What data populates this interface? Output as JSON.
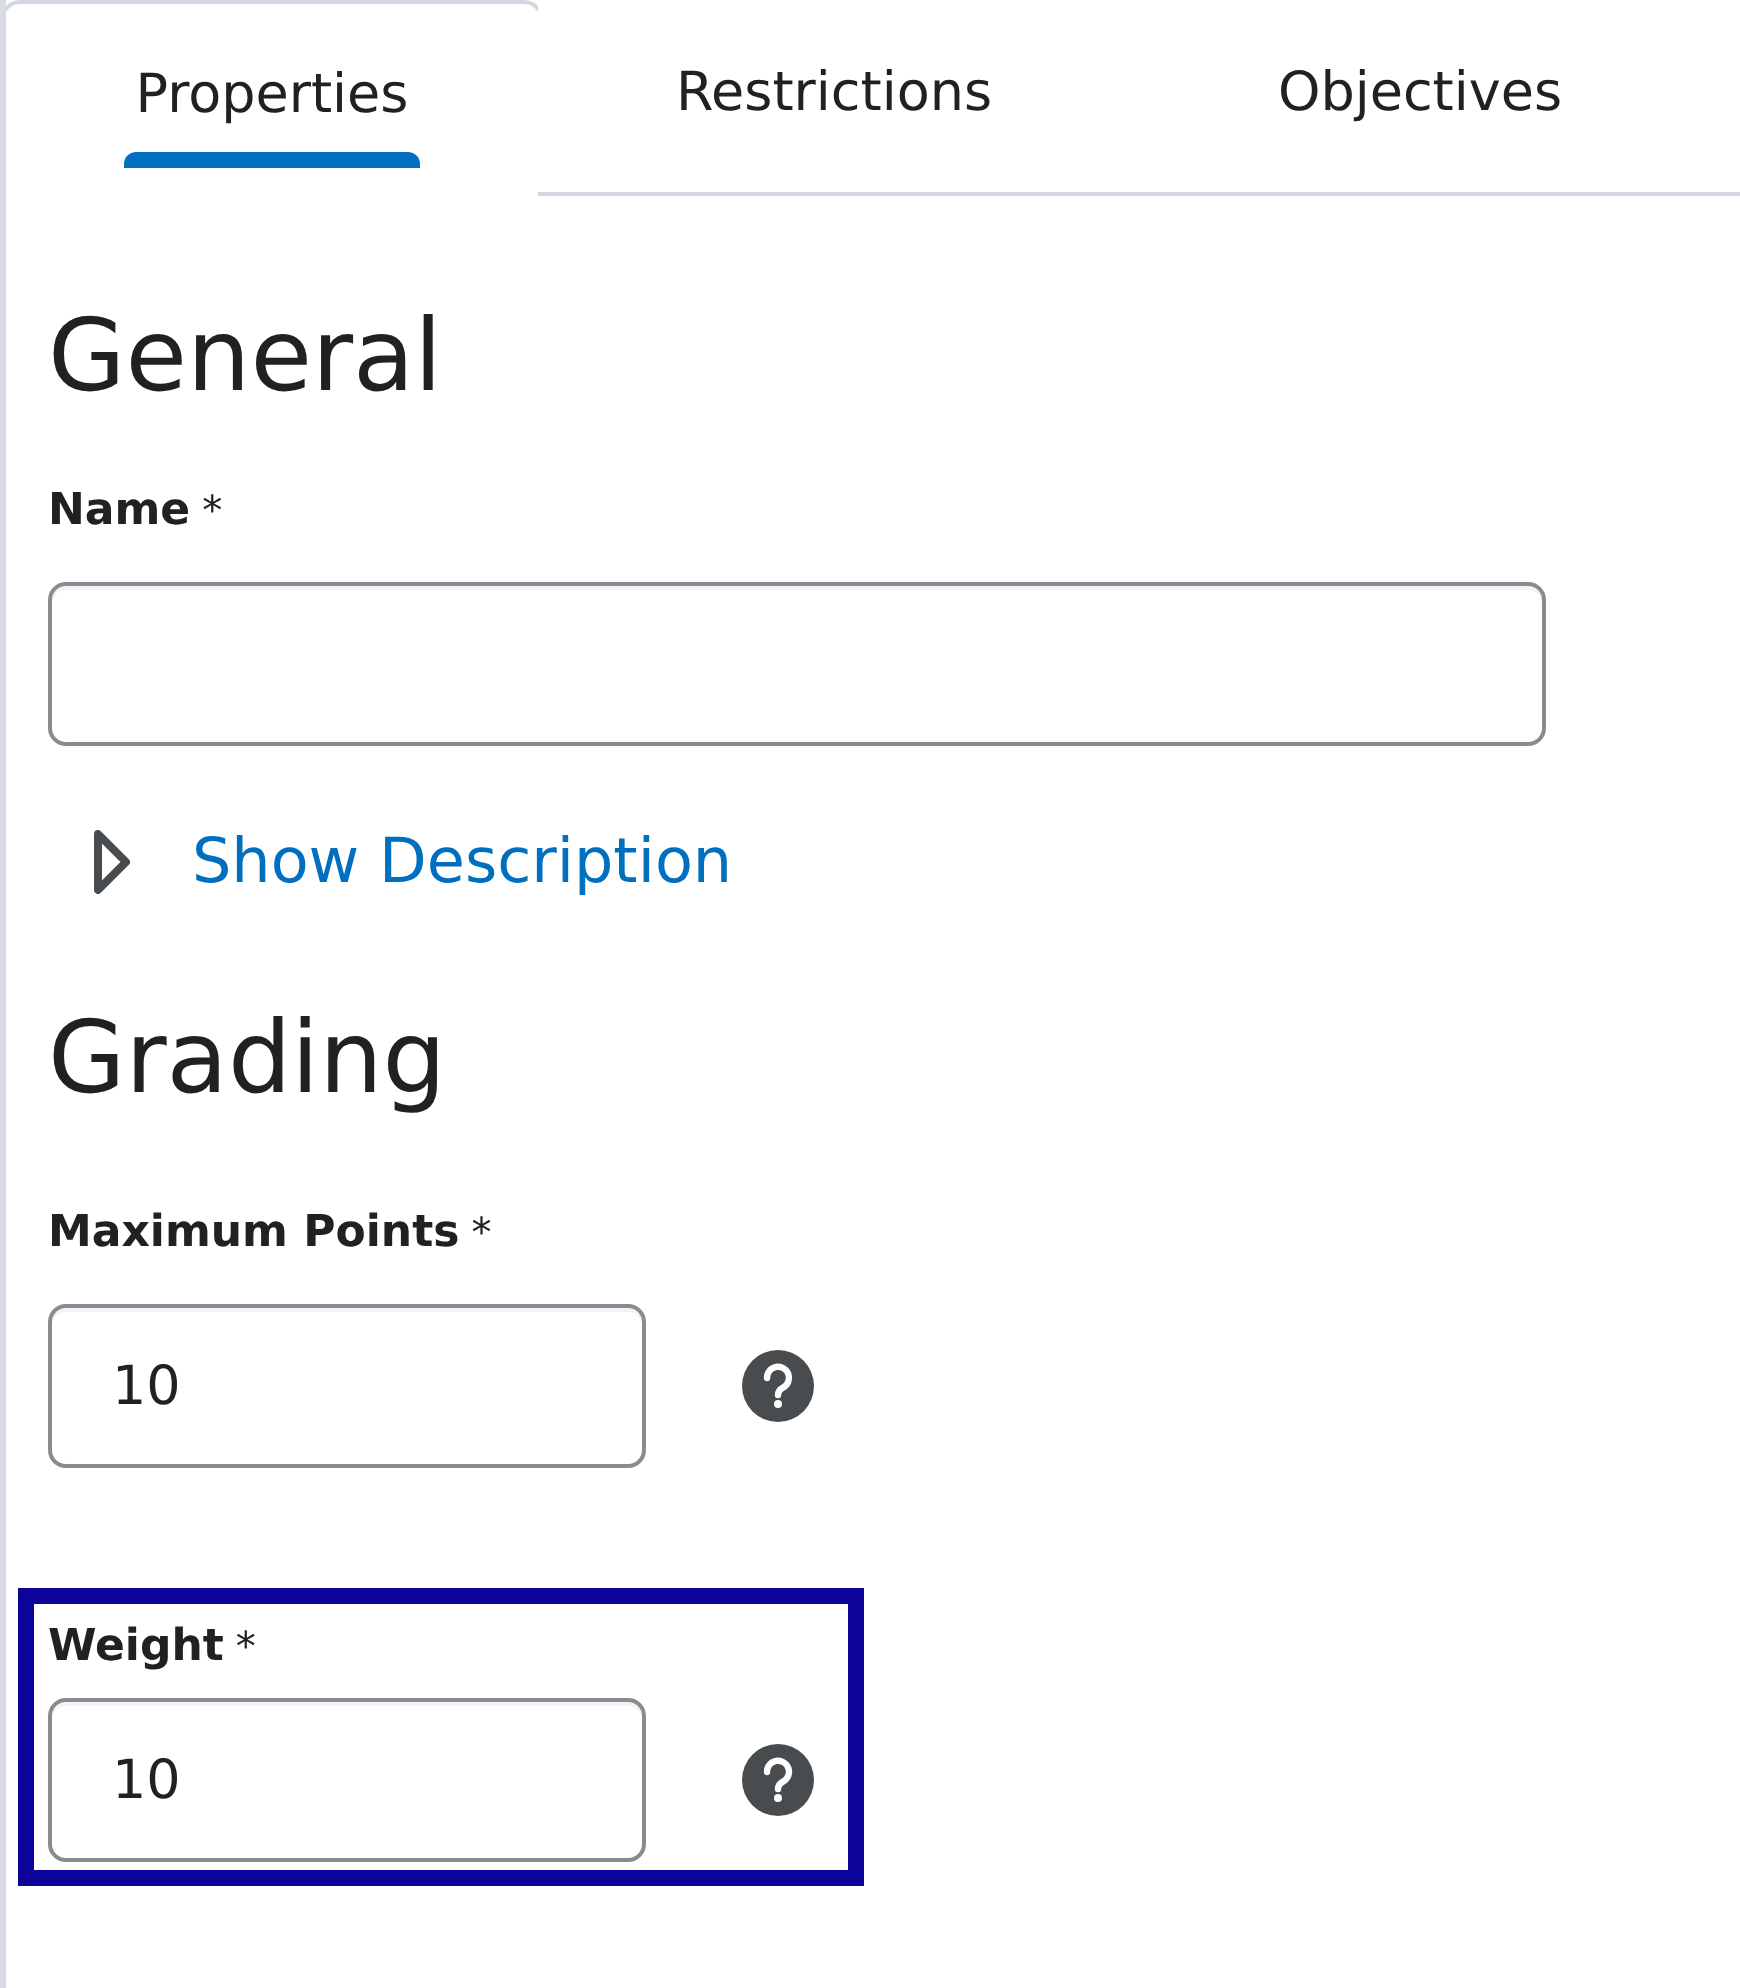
{
  "tabs": [
    {
      "label": "Properties",
      "selected": true
    },
    {
      "label": "Restrictions",
      "selected": false
    },
    {
      "label": "Objectives",
      "selected": false
    }
  ],
  "sections": [
    {
      "heading": "General",
      "items": [
        {
          "kind": "text",
          "label": "Name",
          "required_mark": "*"
        },
        {
          "kind": "toggle",
          "label": "Show Description",
          "expanded": false
        }
      ]
    },
    {
      "heading": "Grading",
      "items": [
        {
          "kind": "number",
          "label": "Maximum Points",
          "required_mark": "*",
          "value": "10",
          "highlighted": false
        },
        {
          "kind": "number",
          "label": "Weight",
          "required_mark": "*",
          "value": "10",
          "highlighted": true
        }
      ]
    }
  ]
}
